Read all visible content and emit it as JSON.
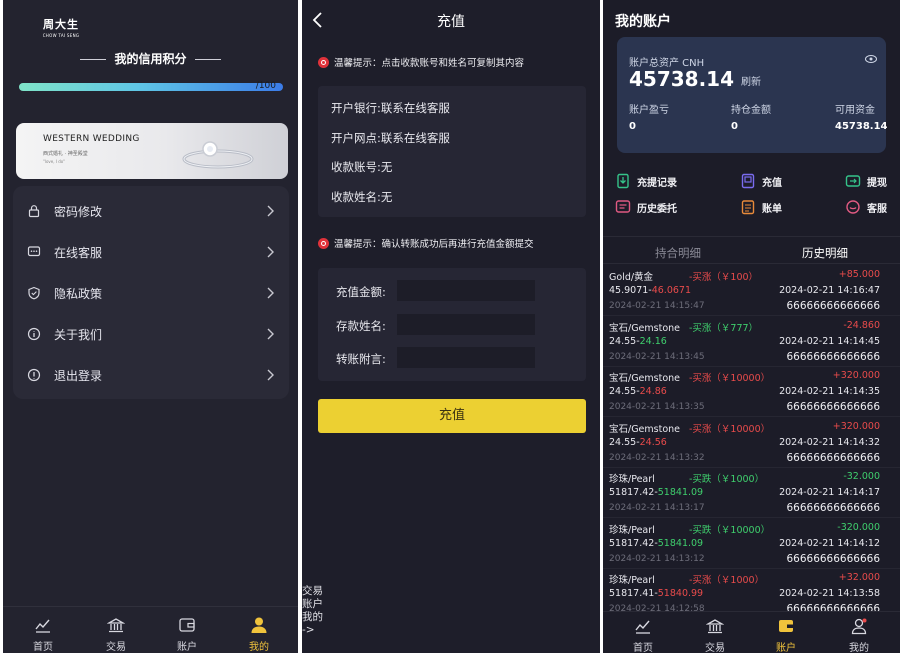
{
  "profile": {
    "logo_cn": "周大生",
    "logo_en": "CHOW TAI SENG",
    "credit_title": "我的信用积分",
    "credit_value_label": "/100",
    "credit_progress": 1.0,
    "banner_title": "WESTERN WEDDING",
    "banner_sub": "西式婚礼 · 神圣殿堂",
    "banner_sub2": "\"love, I do\"",
    "menu": [
      {
        "label": "密码修改",
        "icon": "lock-icon"
      },
      {
        "label": "在线客服",
        "icon": "chat-icon"
      },
      {
        "label": "隐私政策",
        "icon": "shield-icon"
      },
      {
        "label": "关于我们",
        "icon": "info-icon"
      },
      {
        "label": "退出登录",
        "icon": "logout-icon"
      }
    ],
    "tabs": [
      {
        "label": "首页",
        "icon": "chart-line-icon"
      },
      {
        "label": "交易",
        "icon": "bank-icon"
      },
      {
        "label": "账户",
        "icon": "wallet-icon"
      },
      {
        "label": "我的",
        "icon": "user-icon"
      }
    ],
    "active_tab": "我的"
  },
  "recharge": {
    "title": "充值",
    "hint1": "温馨提示：点击收款账号和姓名可复制其内容",
    "bank_rows": [
      {
        "label": "开户银行:",
        "value": "联系在线客服"
      },
      {
        "label": "开户网点:",
        "value": "联系在线客服"
      },
      {
        "label": "收款账号:",
        "value": "无"
      },
      {
        "label": "收款姓名:",
        "value": "无"
      }
    ],
    "hint2": "温馨提示：确认转账成功后再进行充值金额提交",
    "form": [
      {
        "label": "充值金额:",
        "value": ""
      },
      {
        "label": "存款姓名:",
        "value": ""
      },
      {
        "label": "转账附言:",
        "value": ""
      }
    ],
    "submit_label": "充值",
    "stray_text": [
      "交易",
      "账户",
      "我的",
      "->"
    ]
  },
  "account": {
    "title": "我的账户",
    "total_label": "账户总资产 CNH",
    "total_value": "45738.14",
    "refresh_label": "刷新",
    "stats": [
      {
        "label": "账户盈亏",
        "value": "0"
      },
      {
        "label": "持仓金额",
        "value": "0"
      },
      {
        "label": "可用资金",
        "value": "45738.14"
      }
    ],
    "quick_actions": [
      {
        "label": "充提记录",
        "icon": "deposit-record-icon",
        "color": "#35c38a"
      },
      {
        "label": "充值",
        "icon": "recharge-icon",
        "color": "#7a6cf0"
      },
      {
        "label": "提现",
        "icon": "withdraw-icon",
        "color": "#35c38a"
      },
      {
        "label": "历史委托",
        "icon": "history-order-icon",
        "color": "#e05a82"
      },
      {
        "label": "账单",
        "icon": "bill-icon",
        "color": "#e88a3a"
      },
      {
        "label": "客服",
        "icon": "service-icon",
        "color": "#e05a82"
      }
    ],
    "history_tabs": {
      "left": "持合明细",
      "right": "历史明细",
      "active": "历史明细"
    },
    "records": [
      {
        "name": "Gold/黄金",
        "dir": "-买涨（￥100）",
        "dir_color": "red",
        "pnl": "+85.000",
        "pnl_color": "red",
        "open": "45.9071-",
        "close": "46.0671",
        "close_color": "red",
        "t1": "2024-02-21 14:15:47",
        "t2": "2024-02-21 14:16:47",
        "id": "66666666666666"
      },
      {
        "name": "宝石/Gemstone",
        "dir": "-买涨（￥777）",
        "dir_color": "green",
        "pnl": "-24.860",
        "pnl_color": "red",
        "open": "24.55-",
        "close": "24.16",
        "close_color": "green",
        "t1": "2024-02-21 14:13:45",
        "t2": "2024-02-21 14:14:45",
        "id": "66666666666666"
      },
      {
        "name": "宝石/Gemstone",
        "dir": "-买涨（￥10000）",
        "dir_color": "red",
        "pnl": "+320.000",
        "pnl_color": "red",
        "open": "24.55-",
        "close": "24.86",
        "close_color": "red",
        "t1": "2024-02-21 14:13:35",
        "t2": "2024-02-21 14:14:35",
        "id": "66666666666666"
      },
      {
        "name": "宝石/Gemstone",
        "dir": "-买涨（￥10000）",
        "dir_color": "red",
        "pnl": "+320.000",
        "pnl_color": "red",
        "open": "24.55-",
        "close": "24.56",
        "close_color": "red",
        "t1": "2024-02-21 14:13:32",
        "t2": "2024-02-21 14:14:32",
        "id": "66666666666666"
      },
      {
        "name": "珍珠/Pearl",
        "dir": "-买跌（￥1000）",
        "dir_color": "green",
        "pnl": "-32.000",
        "pnl_color": "green",
        "open": "51817.42-",
        "close": "51841.09",
        "close_color": "green",
        "t1": "2024-02-21 14:13:17",
        "t2": "2024-02-21 14:14:17",
        "id": "66666666666666"
      },
      {
        "name": "珍珠/Pearl",
        "dir": "-买跌（￥10000）",
        "dir_color": "green",
        "pnl": "-320.000",
        "pnl_color": "green",
        "open": "51817.42-",
        "close": "51841.09",
        "close_color": "green",
        "t1": "2024-02-21 14:13:12",
        "t2": "2024-02-21 14:14:12",
        "id": "66666666666666"
      },
      {
        "name": "珍珠/Pearl",
        "dir": "-买涨（￥1000）",
        "dir_color": "red",
        "pnl": "+32.000",
        "pnl_color": "red",
        "open": "51817.41-",
        "close": "51840.99",
        "close_color": "red",
        "t1": "2024-02-21 14:12:58",
        "t2": "2024-02-21 14:13:58",
        "id": "66666666666666"
      }
    ],
    "tabs": [
      {
        "label": "首页",
        "icon": "chart-line-icon"
      },
      {
        "label": "交易",
        "icon": "bank-icon"
      },
      {
        "label": "账户",
        "icon": "wallet-icon"
      },
      {
        "label": "我的",
        "icon": "user-icon"
      }
    ],
    "active_tab": "账户"
  }
}
